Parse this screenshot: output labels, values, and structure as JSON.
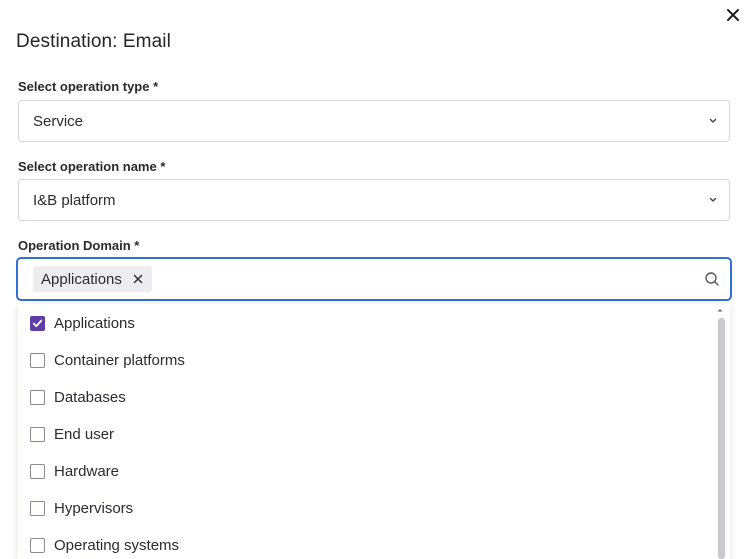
{
  "dialog": {
    "title": "Destination: Email",
    "close_icon": "close-icon"
  },
  "fields": {
    "operation_type": {
      "label": "Select operation type *",
      "value": "Service"
    },
    "operation_name": {
      "label": "Select operation name *",
      "value": "I&B platform"
    },
    "operation_domain": {
      "label": "Operation Domain *",
      "selected_chip": "Applications",
      "focus_color": "#2f6fd6"
    }
  },
  "options": [
    {
      "label": "Applications",
      "checked": true
    },
    {
      "label": "Container platforms",
      "checked": false
    },
    {
      "label": "Databases",
      "checked": false
    },
    {
      "label": "End user",
      "checked": false
    },
    {
      "label": "Hardware",
      "checked": false
    },
    {
      "label": "Hypervisors",
      "checked": false
    },
    {
      "label": "Operating systems",
      "checked": false
    }
  ],
  "colors": {
    "checkbox_checked": "#5f3ea8"
  }
}
